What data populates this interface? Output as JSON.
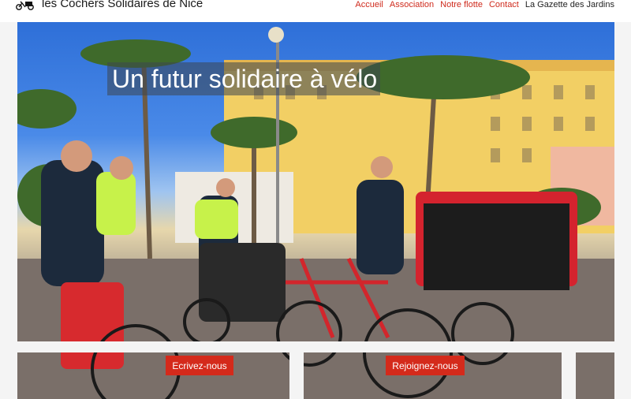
{
  "header": {
    "site_title": "les Cochers Solidaires de Nice",
    "logo_icon": "bicycle-rickshaw-icon",
    "nav": [
      {
        "label": "Accueil",
        "color": "#cf2a1c"
      },
      {
        "label": "Association",
        "color": "#cf2a1c"
      },
      {
        "label": "Notre flotte",
        "color": "#cf2a1c"
      },
      {
        "label": "Contact",
        "color": "#cf2a1c"
      },
      {
        "label": "La Gazette des Jardins",
        "color": "#222222"
      }
    ]
  },
  "hero": {
    "title": "Un futur solidaire à vélo",
    "buttons": {
      "write_label": "Ecrivez-nous",
      "join_label": "Rejoignez-nous"
    }
  },
  "colors": {
    "accent": "#d42a1b",
    "nav_link": "#cf2a1c"
  }
}
